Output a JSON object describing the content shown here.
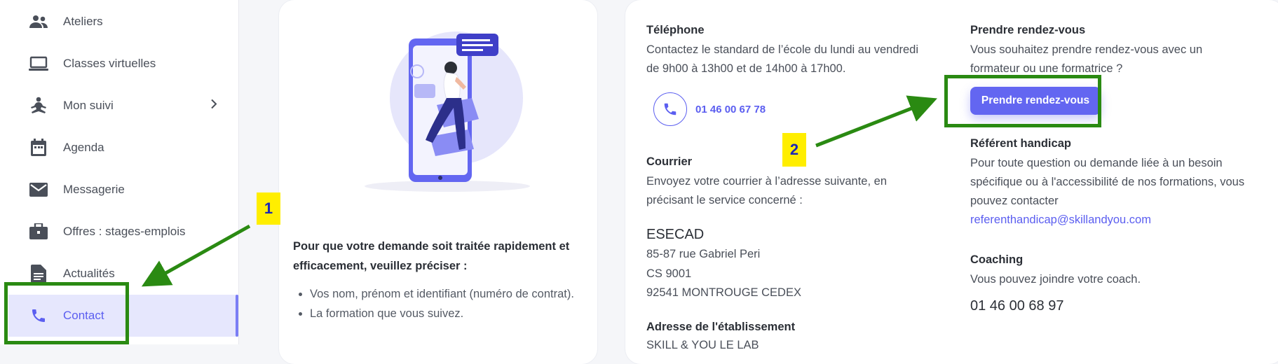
{
  "sidebar": {
    "items": [
      {
        "label": "Ateliers",
        "icon": "group-icon"
      },
      {
        "label": "Classes virtuelles",
        "icon": "laptop-icon"
      },
      {
        "label": "Mon suivi",
        "icon": "meditation-icon"
      },
      {
        "label": "Agenda",
        "icon": "calendar-icon"
      },
      {
        "label": "Messagerie",
        "icon": "mail-icon"
      },
      {
        "label": "Offres : stages-emplois",
        "icon": "briefcase-icon"
      },
      {
        "label": "Actualités",
        "icon": "article-icon"
      },
      {
        "label": "Contact",
        "icon": "phone-icon",
        "active": true
      }
    ]
  },
  "left_card": {
    "lead": "Pour que votre demande soit traitée rapidement et efficacement, veuillez préciser :",
    "bullets": [
      "Vos nom, prénom et identifiant (numéro de contrat).",
      "La formation que vous suivez."
    ]
  },
  "contact": {
    "telephone": {
      "title": "Téléphone",
      "text": "Contactez le standard de l’école du lundi au vendredi de 9h00 à 13h00 et de 14h00 à 17h00.",
      "number": "01 46 00 67 78"
    },
    "courrier": {
      "title": "Courrier",
      "text": "Envoyez votre courrier à l’adresse suivante, en précisant le service concerné :",
      "name": "ESECAD",
      "line1": "85-87 rue Gabriel Peri",
      "line2": "CS 9001",
      "line3": "92541 MONTROUGE CEDEX"
    },
    "adresse": {
      "title": "Adresse de l'établissement",
      "partial": "SKILL & YOU LE LAB"
    },
    "rdv": {
      "title": "Prendre rendez-vous",
      "text": "Vous souhaitez prendre rendez-vous avec un formateur ou une formatrice ?",
      "button": "Prendre rendez-vous"
    },
    "handicap": {
      "title": "Référent handicap",
      "text": "Pour toute question ou demande liée à un besoin spécifique ou à l'accessibilité de nos formations, vous pouvez contacter",
      "email": "referenthandicap@skillandyou.com"
    },
    "coaching": {
      "title": "Coaching",
      "text": "Vous pouvez joindre votre coach.",
      "number": "01 46 00 68 97"
    }
  },
  "annotations": {
    "label1": "1",
    "label2": "2",
    "color": "#2a8a12",
    "label_bg": "#ffee00"
  },
  "colors": {
    "accent": "#6366f1",
    "active_bg": "#e6e7fd"
  }
}
